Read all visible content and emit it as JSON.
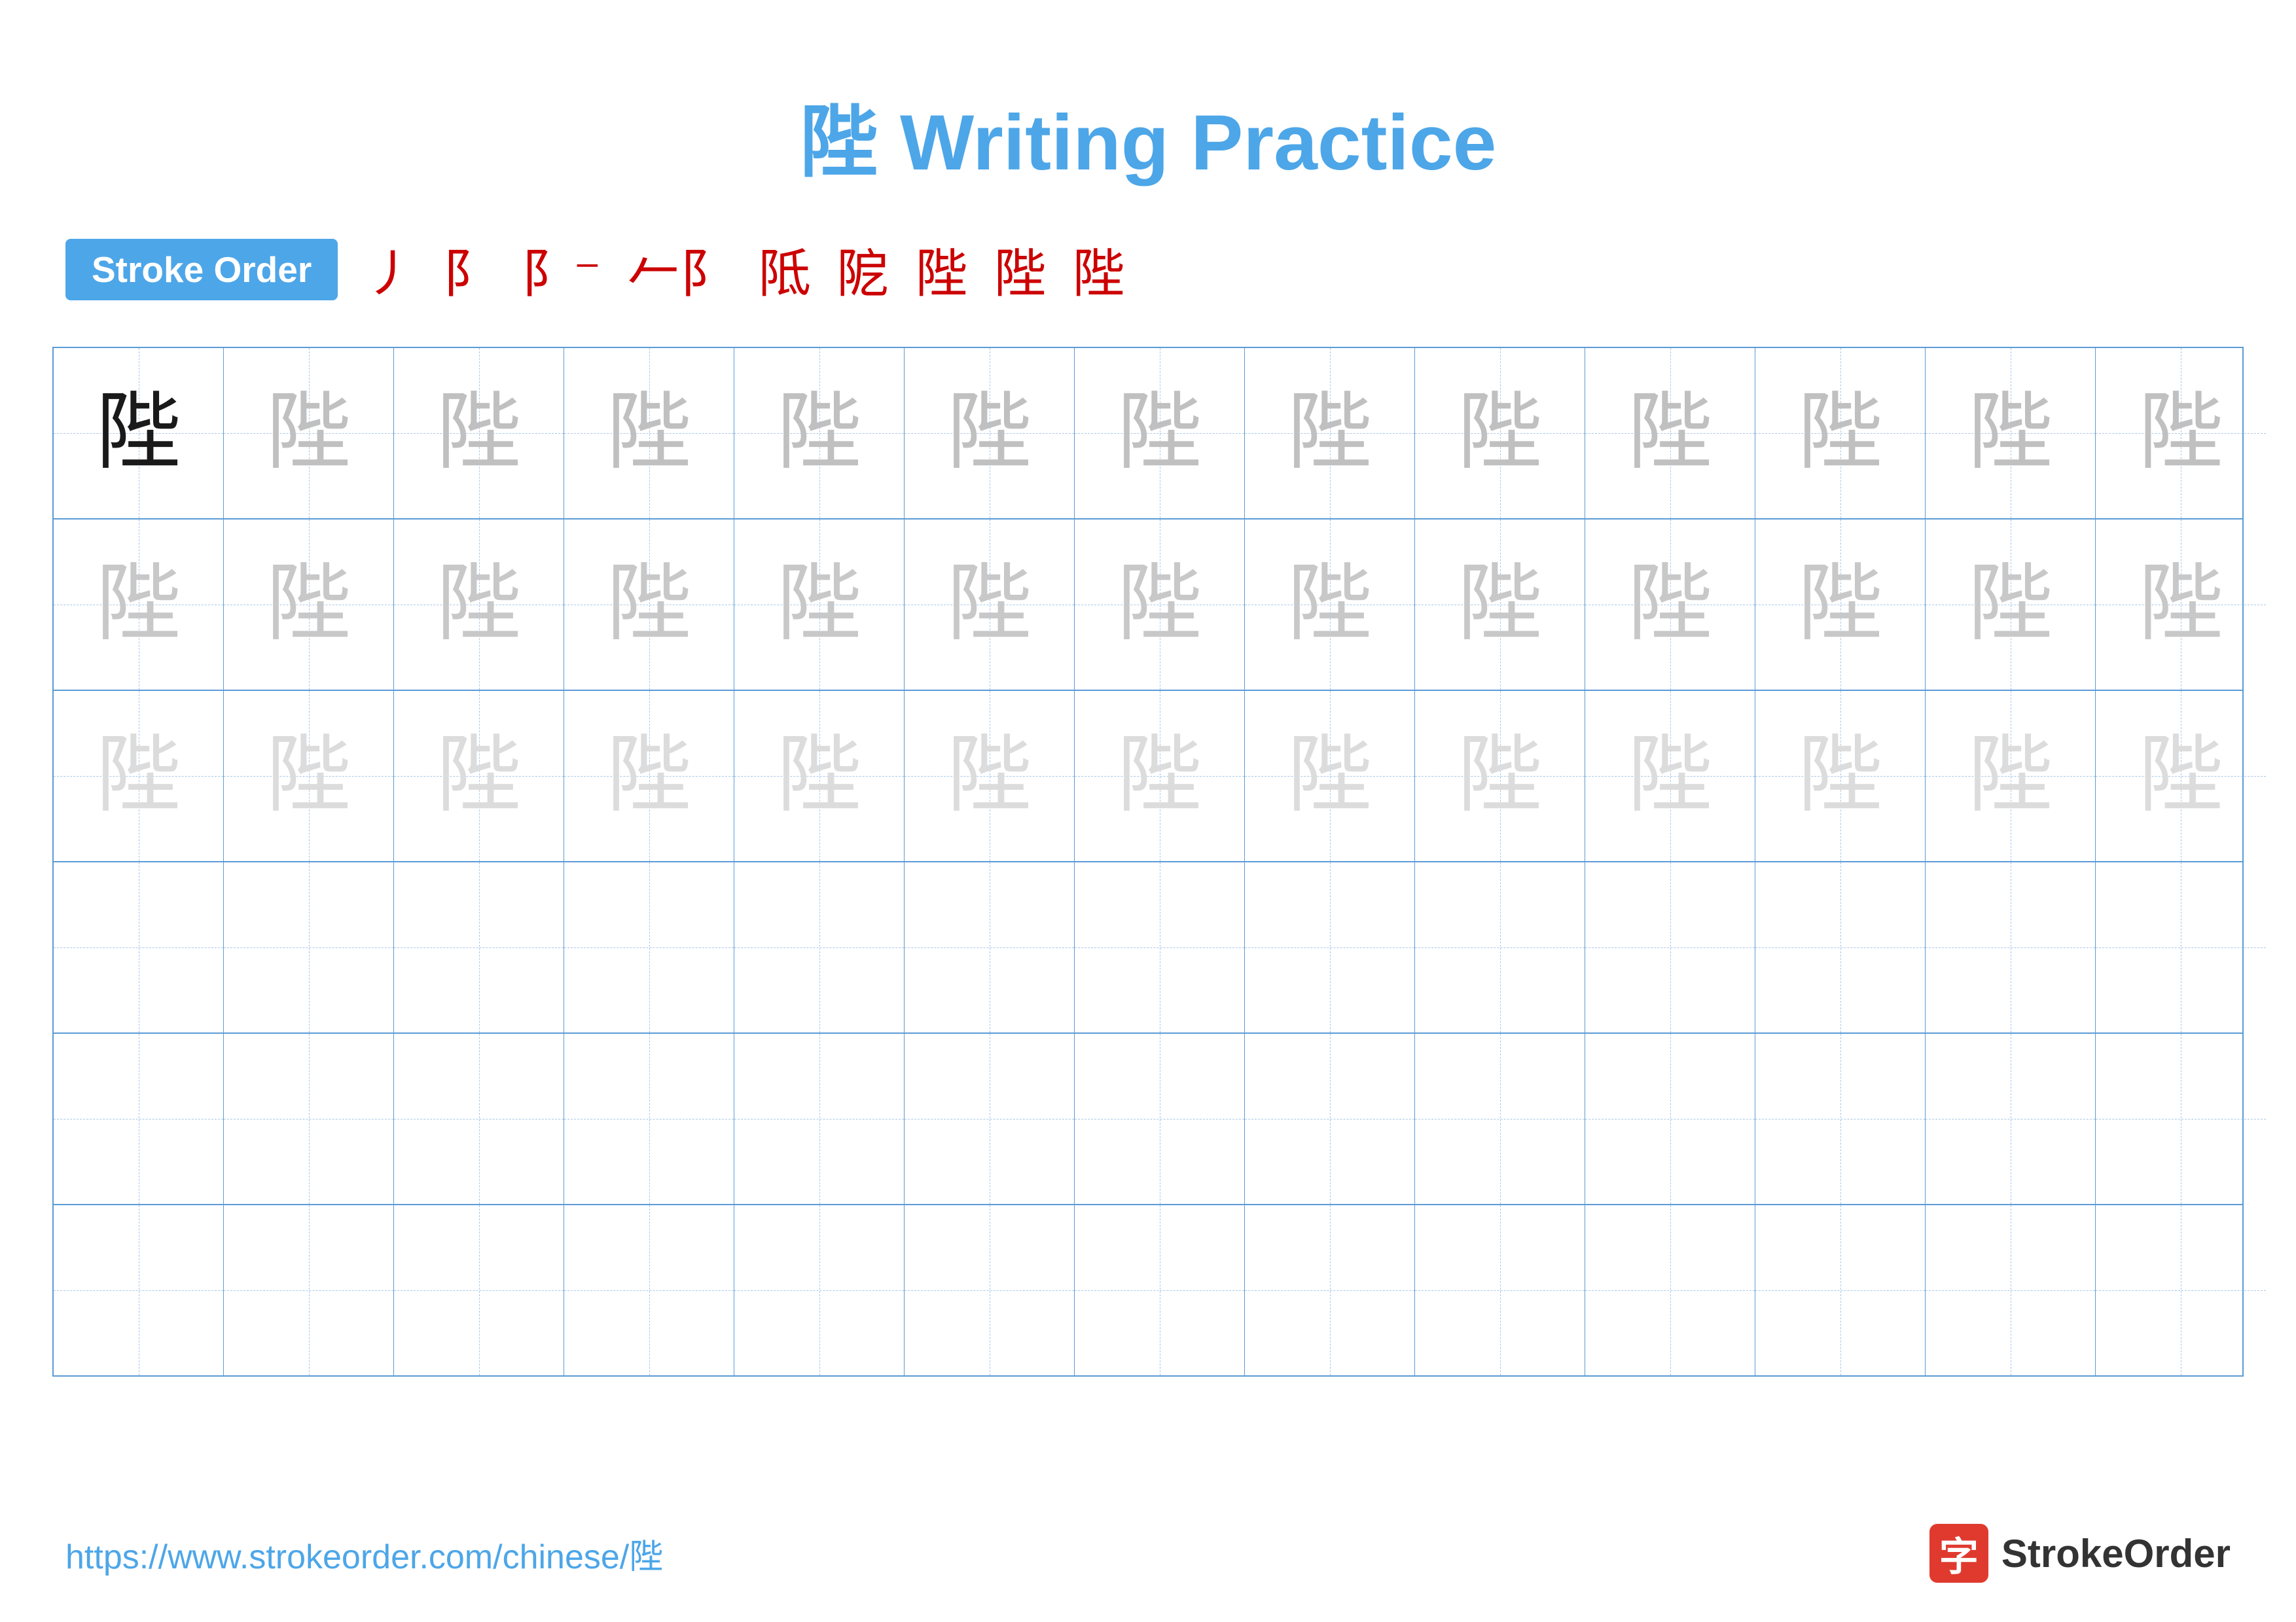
{
  "page": {
    "title": "陛 Writing Practice",
    "character": "陛",
    "stroke_order_label": "Stroke Order",
    "stroke_steps": [
      "㇓",
      "阝",
      "阝⁻",
      "阝⺊",
      "阝⺊⁺",
      "阝比",
      "阝陛",
      "陛⁻",
      "陛"
    ],
    "footer_url": "https://www.strokeorder.com/chinese/陛",
    "brand_name": "StrokeOrder",
    "brand_icon_char": "字",
    "grid": {
      "cols": 13,
      "rows": 6,
      "char_rows": [
        {
          "shade": "dark",
          "count": 13
        },
        {
          "shade": "medium",
          "count": 13
        },
        {
          "shade": "light",
          "count": 13
        },
        {
          "shade": "empty",
          "count": 13
        },
        {
          "shade": "empty",
          "count": 13
        },
        {
          "shade": "empty",
          "count": 13
        }
      ]
    }
  }
}
